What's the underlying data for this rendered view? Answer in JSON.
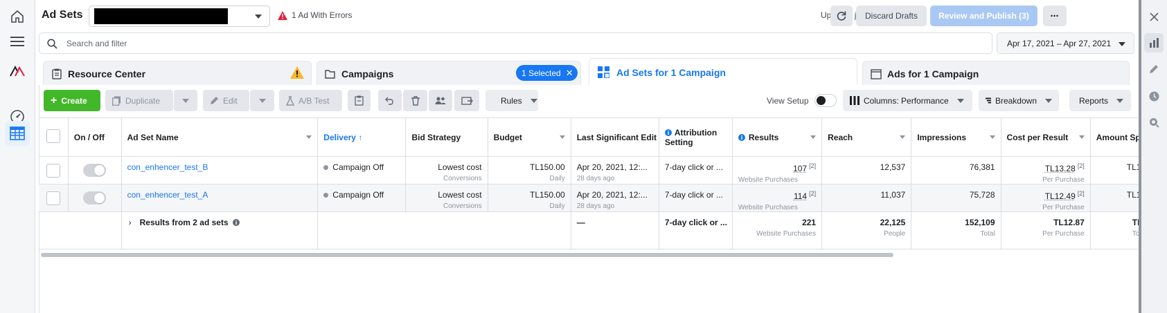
{
  "header": {
    "title": "Ad Sets",
    "errors": "1 Ad With Errors",
    "updated": "Updated just now",
    "discard_label": "Discard Drafts",
    "review_label": "Review and Publish (3)"
  },
  "search": {
    "placeholder": "Search and filter"
  },
  "date_range": "Apr 17, 2021 – Apr 27, 2021",
  "tabs": {
    "resource_center": "Resource Center",
    "campaigns": "Campaigns",
    "selected_pill": "1 Selected",
    "adsets": "Ad Sets for 1 Campaign",
    "ads": "Ads for 1 Campaign"
  },
  "toolbar": {
    "create": "Create",
    "duplicate": "Duplicate",
    "edit": "Edit",
    "ab_test": "A/B Test",
    "rules": "Rules",
    "view_setup": "View Setup",
    "columns": "Columns: Performance",
    "breakdown": "Breakdown",
    "reports": "Reports"
  },
  "table": {
    "headers": {
      "onoff": "On / Off",
      "name": "Ad Set Name",
      "delivery": "Delivery ↑",
      "bid": "Bid Strategy",
      "budget": "Budget",
      "last_edit": "Last Significant Edit",
      "attribution": "Attribution Setting",
      "results": "Results",
      "reach": "Reach",
      "impressions": "Impressions",
      "cpr": "Cost per Result",
      "amount": "Amount Spent"
    },
    "rows": [
      {
        "name": "con_enhencer_test_B",
        "delivery": "Campaign Off",
        "bid": "Lowest cost",
        "bid_sub": "Conversions",
        "budget": "TL150.00",
        "budget_sub": "Daily",
        "last_edit": "Apr 20, 2021, 12:...",
        "last_edit_sub": "28 days ago",
        "attribution": "7-day click or ...",
        "results": "107",
        "results_fn": "[2]",
        "results_sub": "Website Purchases",
        "reach": "12,537",
        "impressions": "76,381",
        "cpr": "TL13.28",
        "cpr_fn": "[2]",
        "cpr_sub": "Per Purchase",
        "amount": "TL1"
      },
      {
        "name": "con_enhencer_test_A",
        "delivery": "Campaign Off",
        "bid": "Lowest cost",
        "bid_sub": "Conversions",
        "budget": "TL150.00",
        "budget_sub": "Daily",
        "last_edit": "Apr 20, 2021, 12:...",
        "last_edit_sub": "28 days ago",
        "attribution": "7-day click or ...",
        "results": "114",
        "results_fn": "[2]",
        "results_sub": "Website Purchases",
        "reach": "11,037",
        "impressions": "75,728",
        "cpr": "TL12.49",
        "cpr_fn": "[2]",
        "cpr_sub": "Per Purchase",
        "amount": "TL1"
      }
    ],
    "total": {
      "label": "Results from 2 ad sets",
      "last_edit": "—",
      "attribution": "7-day click or ...",
      "results": "221",
      "results_sub": "Website Purchases",
      "reach": "22,125",
      "reach_sub": "People",
      "impressions": "152,109",
      "impressions_sub": "Total",
      "cpr": "TL12.87",
      "cpr_sub": "Per Purchase",
      "amount": "TL2",
      "amount_sub": "To"
    }
  },
  "colors": {
    "accent": "#1877f2",
    "create": "#42b72a",
    "review_disabled": "#a9c9f4",
    "warning": "#f7b928",
    "error": "#e41e3f"
  }
}
